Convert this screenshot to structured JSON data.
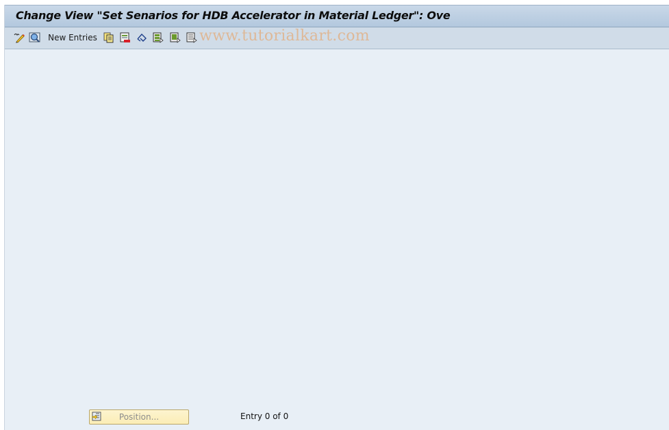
{
  "window": {
    "title": "Change View \"Set Senarios for HDB Accelerator in Material Ledger\": Ove"
  },
  "toolbar": {
    "items": [
      {
        "icon": "display-change-icon",
        "label": ""
      },
      {
        "icon": "details-icon",
        "label": ""
      },
      {
        "icon": "",
        "label": "New Entries"
      },
      {
        "icon": "copy-as-icon",
        "label": ""
      },
      {
        "icon": "delete-icon",
        "label": ""
      },
      {
        "icon": "undo-change-icon",
        "label": ""
      },
      {
        "icon": "select-all-icon",
        "label": ""
      },
      {
        "icon": "select-block-icon",
        "label": ""
      },
      {
        "icon": "deselect-all-icon",
        "label": ""
      }
    ],
    "new_entries_label": "New Entries"
  },
  "watermark": "www.tutorialkart.com",
  "footer": {
    "position_button_label": "Position...",
    "entry_status": "Entry 0 of 0"
  }
}
